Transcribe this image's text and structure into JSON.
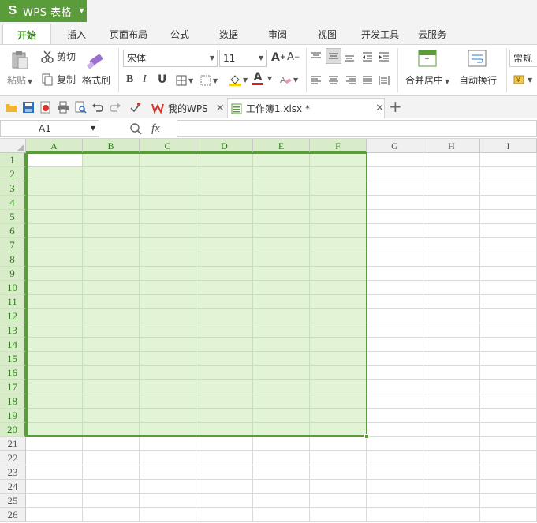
{
  "app": {
    "name": "WPS 表格",
    "logo": "S"
  },
  "tabs": [
    "开始",
    "插入",
    "页面布局",
    "公式",
    "数据",
    "审阅",
    "视图",
    "开发工具",
    "云服务"
  ],
  "ribbon": {
    "paste": "粘贴",
    "cut": "剪切",
    "copy": "复制",
    "format_painter": "格式刷",
    "font_name": "宋体",
    "font_size": "11",
    "bold": "B",
    "italic": "I",
    "underline": "U",
    "font_color_letter": "A",
    "merge_center": "合并居中",
    "wrap_text": "自动换行",
    "number_format": "常规"
  },
  "doc_tabs": [
    {
      "label": "我的WPS"
    },
    {
      "label": "工作簿1.xlsx *"
    }
  ],
  "formula_bar": {
    "cell_ref": "A1",
    "fx_label": "fx",
    "value": ""
  },
  "sheet": {
    "columns": [
      "A",
      "B",
      "C",
      "D",
      "E",
      "F",
      "G",
      "H",
      "I"
    ],
    "rows": [
      "1",
      "2",
      "3",
      "4",
      "5",
      "6",
      "7",
      "8",
      "9",
      "10",
      "11",
      "12",
      "13",
      "14",
      "15",
      "16",
      "17",
      "18",
      "19",
      "20",
      "21",
      "22",
      "23",
      "24",
      "25",
      "26"
    ],
    "selection": "A1:F20",
    "active_cell": "A1"
  },
  "colors": {
    "accent": "#5a9c3a",
    "selection_fill": "#e3f4d6",
    "header_selected": "#d9ecc9"
  }
}
